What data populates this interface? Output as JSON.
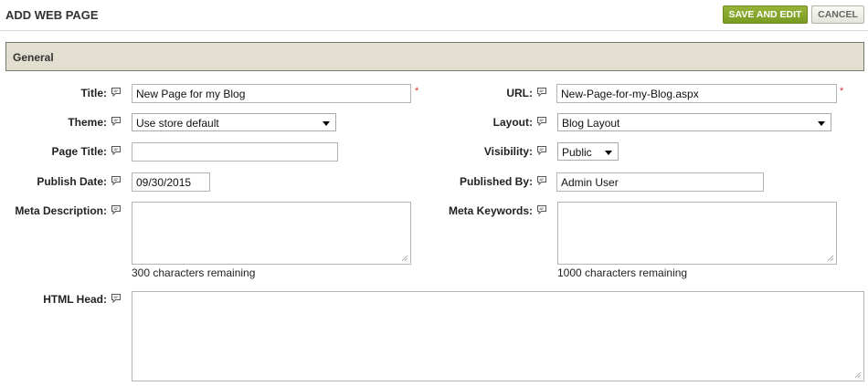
{
  "header": {
    "title": "ADD WEB PAGE",
    "save_label": "SAVE AND EDIT",
    "cancel_label": "CANCEL"
  },
  "section": {
    "title": "General"
  },
  "fields": {
    "title": {
      "label": "Title:",
      "value": "New Page for my Blog",
      "required": "*"
    },
    "url": {
      "label": "URL:",
      "value": "New-Page-for-my-Blog.aspx",
      "required": "*"
    },
    "theme": {
      "label": "Theme:",
      "value": "Use store default"
    },
    "layout": {
      "label": "Layout:",
      "value": "Blog Layout"
    },
    "page_title": {
      "label": "Page Title:",
      "value": ""
    },
    "visibility": {
      "label": "Visibility:",
      "value": "Public"
    },
    "publish_date": {
      "label": "Publish Date:",
      "value": "09/30/2015"
    },
    "published_by": {
      "label": "Published By:",
      "value": "Admin User"
    },
    "meta_description": {
      "label": "Meta Description:",
      "value": "",
      "remaining": "300 characters remaining"
    },
    "meta_keywords": {
      "label": "Meta Keywords:",
      "value": "",
      "remaining": "1000 characters remaining"
    },
    "html_head": {
      "label": "HTML Head:",
      "value": ""
    }
  },
  "icons": {
    "help": "speech-bubble-help-icon",
    "dropdown": "chevron-down-icon",
    "resize": "resize-grip-icon"
  },
  "colors": {
    "save_button": "#7a9a22",
    "section_header_bg": "#e3dfd0",
    "required": "#dd3333"
  }
}
